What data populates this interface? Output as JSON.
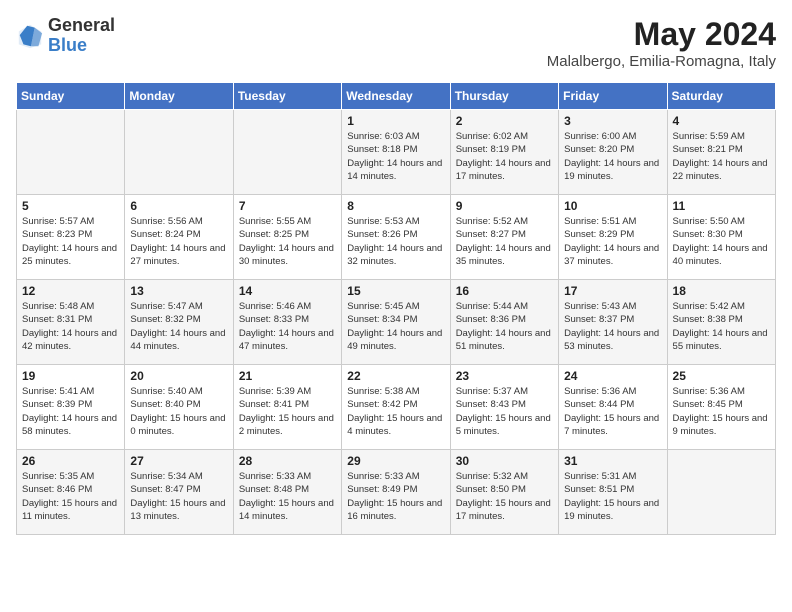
{
  "header": {
    "logo_general": "General",
    "logo_blue": "Blue",
    "month": "May 2024",
    "location": "Malalbergo, Emilia-Romagna, Italy"
  },
  "weekdays": [
    "Sunday",
    "Monday",
    "Tuesday",
    "Wednesday",
    "Thursday",
    "Friday",
    "Saturday"
  ],
  "weeks": [
    [
      {
        "day": "",
        "info": ""
      },
      {
        "day": "",
        "info": ""
      },
      {
        "day": "",
        "info": ""
      },
      {
        "day": "1",
        "info": "Sunrise: 6:03 AM\nSunset: 8:18 PM\nDaylight: 14 hours and 14 minutes."
      },
      {
        "day": "2",
        "info": "Sunrise: 6:02 AM\nSunset: 8:19 PM\nDaylight: 14 hours and 17 minutes."
      },
      {
        "day": "3",
        "info": "Sunrise: 6:00 AM\nSunset: 8:20 PM\nDaylight: 14 hours and 19 minutes."
      },
      {
        "day": "4",
        "info": "Sunrise: 5:59 AM\nSunset: 8:21 PM\nDaylight: 14 hours and 22 minutes."
      }
    ],
    [
      {
        "day": "5",
        "info": "Sunrise: 5:57 AM\nSunset: 8:23 PM\nDaylight: 14 hours and 25 minutes."
      },
      {
        "day": "6",
        "info": "Sunrise: 5:56 AM\nSunset: 8:24 PM\nDaylight: 14 hours and 27 minutes."
      },
      {
        "day": "7",
        "info": "Sunrise: 5:55 AM\nSunset: 8:25 PM\nDaylight: 14 hours and 30 minutes."
      },
      {
        "day": "8",
        "info": "Sunrise: 5:53 AM\nSunset: 8:26 PM\nDaylight: 14 hours and 32 minutes."
      },
      {
        "day": "9",
        "info": "Sunrise: 5:52 AM\nSunset: 8:27 PM\nDaylight: 14 hours and 35 minutes."
      },
      {
        "day": "10",
        "info": "Sunrise: 5:51 AM\nSunset: 8:29 PM\nDaylight: 14 hours and 37 minutes."
      },
      {
        "day": "11",
        "info": "Sunrise: 5:50 AM\nSunset: 8:30 PM\nDaylight: 14 hours and 40 minutes."
      }
    ],
    [
      {
        "day": "12",
        "info": "Sunrise: 5:48 AM\nSunset: 8:31 PM\nDaylight: 14 hours and 42 minutes."
      },
      {
        "day": "13",
        "info": "Sunrise: 5:47 AM\nSunset: 8:32 PM\nDaylight: 14 hours and 44 minutes."
      },
      {
        "day": "14",
        "info": "Sunrise: 5:46 AM\nSunset: 8:33 PM\nDaylight: 14 hours and 47 minutes."
      },
      {
        "day": "15",
        "info": "Sunrise: 5:45 AM\nSunset: 8:34 PM\nDaylight: 14 hours and 49 minutes."
      },
      {
        "day": "16",
        "info": "Sunrise: 5:44 AM\nSunset: 8:36 PM\nDaylight: 14 hours and 51 minutes."
      },
      {
        "day": "17",
        "info": "Sunrise: 5:43 AM\nSunset: 8:37 PM\nDaylight: 14 hours and 53 minutes."
      },
      {
        "day": "18",
        "info": "Sunrise: 5:42 AM\nSunset: 8:38 PM\nDaylight: 14 hours and 55 minutes."
      }
    ],
    [
      {
        "day": "19",
        "info": "Sunrise: 5:41 AM\nSunset: 8:39 PM\nDaylight: 14 hours and 58 minutes."
      },
      {
        "day": "20",
        "info": "Sunrise: 5:40 AM\nSunset: 8:40 PM\nDaylight: 15 hours and 0 minutes."
      },
      {
        "day": "21",
        "info": "Sunrise: 5:39 AM\nSunset: 8:41 PM\nDaylight: 15 hours and 2 minutes."
      },
      {
        "day": "22",
        "info": "Sunrise: 5:38 AM\nSunset: 8:42 PM\nDaylight: 15 hours and 4 minutes."
      },
      {
        "day": "23",
        "info": "Sunrise: 5:37 AM\nSunset: 8:43 PM\nDaylight: 15 hours and 5 minutes."
      },
      {
        "day": "24",
        "info": "Sunrise: 5:36 AM\nSunset: 8:44 PM\nDaylight: 15 hours and 7 minutes."
      },
      {
        "day": "25",
        "info": "Sunrise: 5:36 AM\nSunset: 8:45 PM\nDaylight: 15 hours and 9 minutes."
      }
    ],
    [
      {
        "day": "26",
        "info": "Sunrise: 5:35 AM\nSunset: 8:46 PM\nDaylight: 15 hours and 11 minutes."
      },
      {
        "day": "27",
        "info": "Sunrise: 5:34 AM\nSunset: 8:47 PM\nDaylight: 15 hours and 13 minutes."
      },
      {
        "day": "28",
        "info": "Sunrise: 5:33 AM\nSunset: 8:48 PM\nDaylight: 15 hours and 14 minutes."
      },
      {
        "day": "29",
        "info": "Sunrise: 5:33 AM\nSunset: 8:49 PM\nDaylight: 15 hours and 16 minutes."
      },
      {
        "day": "30",
        "info": "Sunrise: 5:32 AM\nSunset: 8:50 PM\nDaylight: 15 hours and 17 minutes."
      },
      {
        "day": "31",
        "info": "Sunrise: 5:31 AM\nSunset: 8:51 PM\nDaylight: 15 hours and 19 minutes."
      },
      {
        "day": "",
        "info": ""
      }
    ]
  ]
}
